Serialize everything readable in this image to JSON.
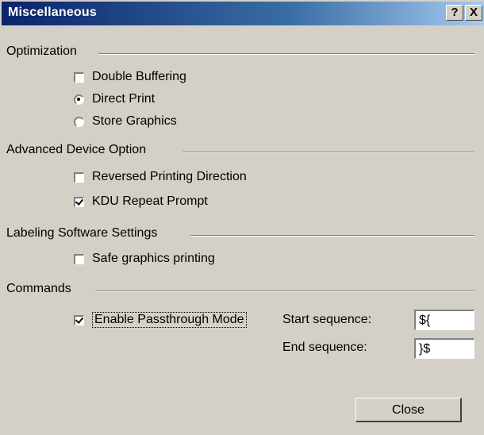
{
  "window": {
    "title": "Miscellaneous",
    "help_label": "?",
    "close_label": "X"
  },
  "sections": {
    "optimization": {
      "label": "Optimization",
      "double_buffering": {
        "label": "Double Buffering",
        "checked": false
      },
      "direct_print": {
        "label": "Direct Print",
        "selected": true
      },
      "store_graphics": {
        "label": "Store Graphics",
        "selected": false
      }
    },
    "advanced": {
      "label": "Advanced Device Option",
      "reversed_printing": {
        "label": "Reversed Printing Direction",
        "checked": false
      },
      "kdu_repeat": {
        "label": "KDU Repeat Prompt",
        "checked": true
      }
    },
    "labeling": {
      "label": "Labeling Software Settings",
      "safe_graphics": {
        "label": "Safe graphics printing",
        "checked": false
      }
    },
    "commands": {
      "label": "Commands",
      "passthrough": {
        "label": "Enable Passthrough Mode",
        "checked": true
      },
      "start_sequence": {
        "label": "Start sequence:",
        "value": "${"
      },
      "end_sequence": {
        "label": "End sequence:",
        "value": "}$"
      }
    }
  },
  "footer": {
    "close_button": "Close"
  }
}
